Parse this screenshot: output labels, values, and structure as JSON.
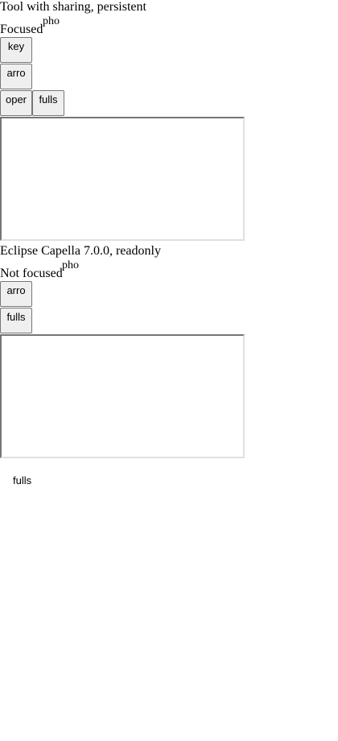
{
  "section1": {
    "title": "Tool with sharing, persistent",
    "status": "Focused",
    "badge": "pho",
    "buttons": {
      "key": "key",
      "arrow": "arro",
      "open": "oper",
      "fullscreen": "fulls"
    }
  },
  "section2": {
    "title": "Eclipse Capella 7.0.0, readonly",
    "status": "Not focused",
    "badge": "pho",
    "buttons": {
      "arrow": "arro",
      "fullscreen": "fulls"
    }
  },
  "footer": {
    "fullscreen_label": "fulls"
  }
}
